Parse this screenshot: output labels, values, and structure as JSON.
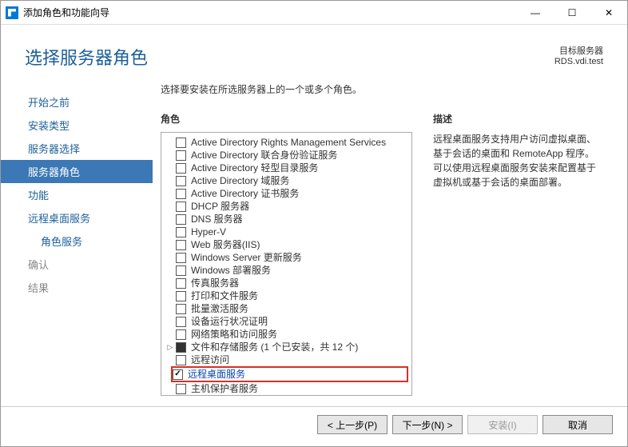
{
  "window": {
    "title": "添加角色和功能向导",
    "min": "—",
    "max": "☐",
    "close": "✕"
  },
  "header": {
    "page_title": "选择服务器角色",
    "target_label": "目标服务器",
    "target_value": "RDS.vdi.test"
  },
  "nav": {
    "items": [
      {
        "label": "开始之前"
      },
      {
        "label": "安装类型"
      },
      {
        "label": "服务器选择"
      },
      {
        "label": "服务器角色",
        "active": true
      },
      {
        "label": "功能"
      },
      {
        "label": "远程桌面服务"
      },
      {
        "label": "角色服务",
        "sub": true
      },
      {
        "label": "确认",
        "disabled": true
      },
      {
        "label": "结果",
        "disabled": true
      }
    ]
  },
  "main": {
    "instruction": "选择要安装在所选服务器上的一个或多个角色。",
    "roles_label": "角色",
    "desc_label": "描述",
    "desc_text": "远程桌面服务支持用户访问虚拟桌面、基于会话的桌面和 RemoteApp 程序。可以使用远程桌面服务安装来配置基于虚拟机或基于会话的桌面部署。",
    "roles": [
      {
        "label": "Active Directory Rights Management Services"
      },
      {
        "label": "Active Directory 联合身份验证服务"
      },
      {
        "label": "Active Directory 轻型目录服务"
      },
      {
        "label": "Active Directory 域服务"
      },
      {
        "label": "Active Directory 证书服务"
      },
      {
        "label": "DHCP 服务器"
      },
      {
        "label": "DNS 服务器"
      },
      {
        "label": "Hyper-V"
      },
      {
        "label": "Web 服务器(IIS)"
      },
      {
        "label": "Windows Server 更新服务"
      },
      {
        "label": "Windows 部署服务"
      },
      {
        "label": "传真服务器"
      },
      {
        "label": "打印和文件服务"
      },
      {
        "label": "批量激活服务"
      },
      {
        "label": "设备运行状况证明"
      },
      {
        "label": "网络策略和访问服务"
      },
      {
        "label": "文件和存储服务 (1 个已安装，共 12 个)",
        "expandable": true,
        "filled": true
      },
      {
        "label": "远程访问"
      },
      {
        "label": "远程桌面服务",
        "checked": true,
        "highlighted": true
      },
      {
        "label": "主机保护者服务"
      }
    ]
  },
  "footer": {
    "prev": "< 上一步(P)",
    "next": "下一步(N) >",
    "install": "安装(I)",
    "cancel": "取消"
  }
}
